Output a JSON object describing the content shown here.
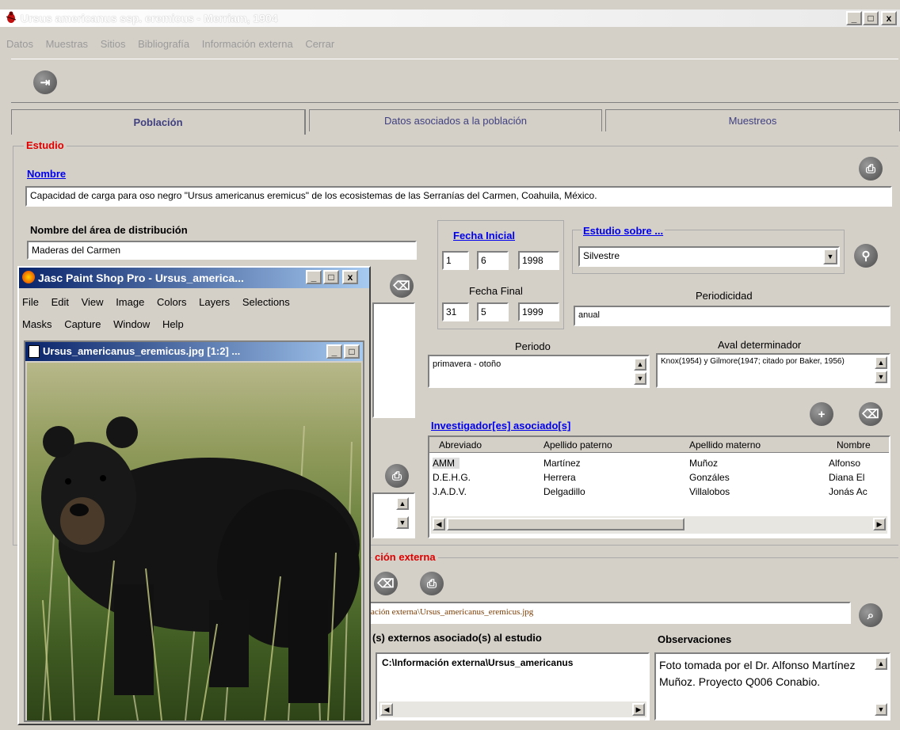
{
  "main_window": {
    "title": "Ursus americanus ssp. eremicus - Merriam, 1904",
    "controls": [
      "_",
      "□",
      "x"
    ],
    "menu": [
      "Datos",
      "Muestras",
      "Sitios",
      "Bibliografía",
      "Información externa",
      "Cerrar"
    ],
    "toolbar_icon": "exit-door-icon"
  },
  "tabs": [
    "Población",
    "Datos asociados a la población",
    "Muestreos"
  ],
  "estudio": {
    "section_label": "Estudio",
    "nombre_label": "Nombre",
    "nombre_value": "Capacidad de carga para oso negro \"Ursus americanus eremicus\" de los ecosistemas de las Serranías del Carmen, Coahuila, México.",
    "area_label": "Nombre del área de distribución",
    "area_value": "Maderas del Carmen",
    "fecha_inicial_label": "Fecha Inicial",
    "fecha_inicial": [
      "1",
      "6",
      "1998"
    ],
    "fecha_final_label": "Fecha Final",
    "fecha_final": [
      "31",
      "5",
      "1999"
    ],
    "estudio_sobre_label": "Estudio sobre ...",
    "estudio_sobre_value": "Silvestre",
    "periodicidad_label": "Periodicidad",
    "periodicidad_value": "anual",
    "periodo_label": "Periodo",
    "periodo_value": "primavera - otoño",
    "aval_label": "Aval determinador",
    "aval_value": "Knox(1954) y Gilmore(1947; citado por Baker, 1956)"
  },
  "investigadores": {
    "label": "Investigador[es] asociado[s]",
    "columns": [
      "Abreviado",
      "Apellido paterno",
      "Apellido materno",
      "Nombre"
    ],
    "rows": [
      [
        "AMM",
        "Martínez",
        "Muñoz",
        "Alfonso"
      ],
      [
        "D.E.H.G.",
        "Herrera",
        "Gonzáles",
        "Diana El"
      ],
      [
        "J.A.D.V.",
        "Delgadillo",
        "Villalobos",
        "Jonás Ac"
      ]
    ]
  },
  "info_externa": {
    "section_label": "ción externa",
    "path_value": "ación externa\\Ursus_americanus_eremicus.jpg",
    "archivos_label": "(s) externos asociado(s) al estudio",
    "archivo_item": "C:\\Información externa\\Ursus_americanus",
    "observaciones_label": "Observaciones",
    "observaciones_value": "Foto tomada por el Dr. Alfonso Martínez Muñoz. Proyecto Q006 Conabio."
  },
  "psp": {
    "title": "Jasc Paint Shop Pro - Ursus_america...",
    "menu_row1": [
      "File",
      "Edit",
      "View",
      "Image",
      "Colors",
      "Layers",
      "Selections"
    ],
    "menu_row2": [
      "Masks",
      "Capture",
      "Window",
      "Help"
    ],
    "doc_title": "Ursus_americanus_eremicus.jpg [1:2] ..."
  }
}
